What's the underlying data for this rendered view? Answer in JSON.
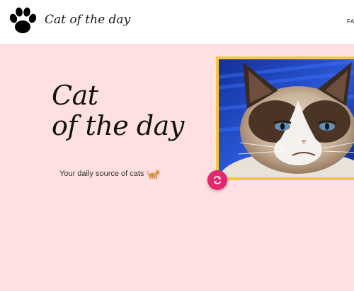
{
  "header": {
    "site_title": "Cat of the day",
    "nav_link": "FAQ"
  },
  "hero": {
    "title_line1": "Cat",
    "title_line2": "of the day",
    "subtitle": "Your daily source of cats"
  },
  "colors": {
    "hero_background": "#fde0df",
    "frame": "#f6c842",
    "refresh_button": "#e3266e"
  },
  "icons": {
    "logo": "paw-icon",
    "subtitle_emoji": "cat-emoji-icon",
    "refresh": "refresh-icon"
  }
}
